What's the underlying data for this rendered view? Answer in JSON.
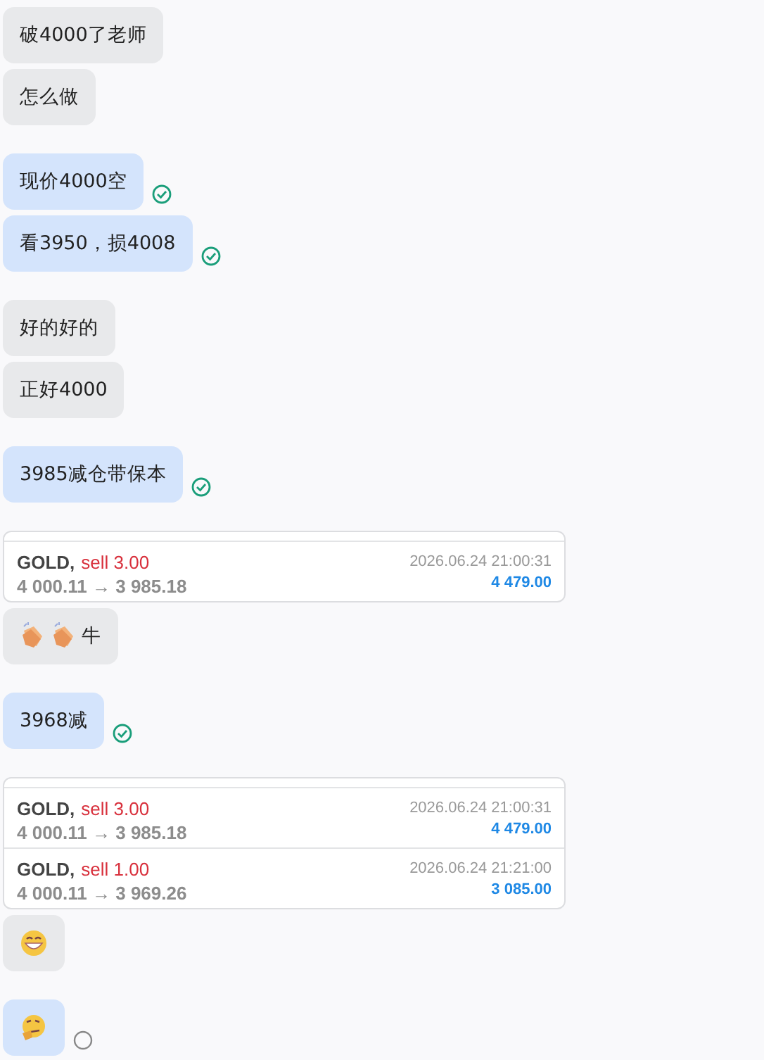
{
  "groups": [
    {
      "messages": [
        {
          "kind": "incoming",
          "parts": [
            {
              "kind": "text",
              "text": "破4000了老师"
            }
          ]
        },
        {
          "kind": "incoming",
          "parts": [
            {
              "kind": "text",
              "text": "怎么做"
            }
          ]
        }
      ]
    },
    {
      "messages": [
        {
          "kind": "outgoing",
          "read": true,
          "parts": [
            {
              "kind": "text",
              "text": "现价4000空"
            }
          ]
        },
        {
          "kind": "outgoing",
          "read": true,
          "parts": [
            {
              "kind": "text",
              "text": "看3950，损4008"
            }
          ]
        }
      ]
    },
    {
      "messages": [
        {
          "kind": "incoming",
          "parts": [
            {
              "kind": "text",
              "text": "好的好的"
            }
          ]
        },
        {
          "kind": "incoming",
          "parts": [
            {
              "kind": "text",
              "text": "正好4000"
            }
          ]
        }
      ]
    },
    {
      "messages": [
        {
          "kind": "outgoing",
          "read": true,
          "parts": [
            {
              "kind": "text",
              "text": "3985减仓带保本"
            }
          ]
        }
      ]
    },
    {
      "messages": [
        {
          "kind": "trades",
          "trades": [
            {
              "symbol": "GOLD,",
              "side": "sell 3.00",
              "prices": "4 000.11 → 3 985.18",
              "time": "2026.06.24 21:00:31",
              "profit": "4 479.00"
            }
          ]
        },
        {
          "kind": "incoming",
          "parts": [
            {
              "kind": "clap"
            },
            {
              "kind": "clap"
            },
            {
              "kind": "text",
              "text": "牛"
            }
          ]
        }
      ]
    },
    {
      "messages": [
        {
          "kind": "outgoing",
          "read": true,
          "parts": [
            {
              "kind": "text",
              "text": "3968减"
            }
          ]
        }
      ]
    },
    {
      "messages": [
        {
          "kind": "trades",
          "trades": [
            {
              "symbol": "GOLD,",
              "side": "sell 3.00",
              "prices": "4 000.11 → 3 985.18",
              "time": "2026.06.24 21:00:31",
              "profit": "4 479.00"
            },
            {
              "symbol": "GOLD,",
              "side": "sell 1.00",
              "prices": "4 000.11 → 3 969.26",
              "time": "2026.06.24 21:21:00",
              "profit": "3 085.00"
            }
          ]
        },
        {
          "kind": "incoming",
          "parts": [
            {
              "kind": "grin"
            }
          ]
        }
      ]
    },
    {
      "messages": [
        {
          "kind": "outgoing",
          "read": false,
          "parts": [
            {
              "kind": "thinking"
            }
          ]
        }
      ]
    }
  ]
}
